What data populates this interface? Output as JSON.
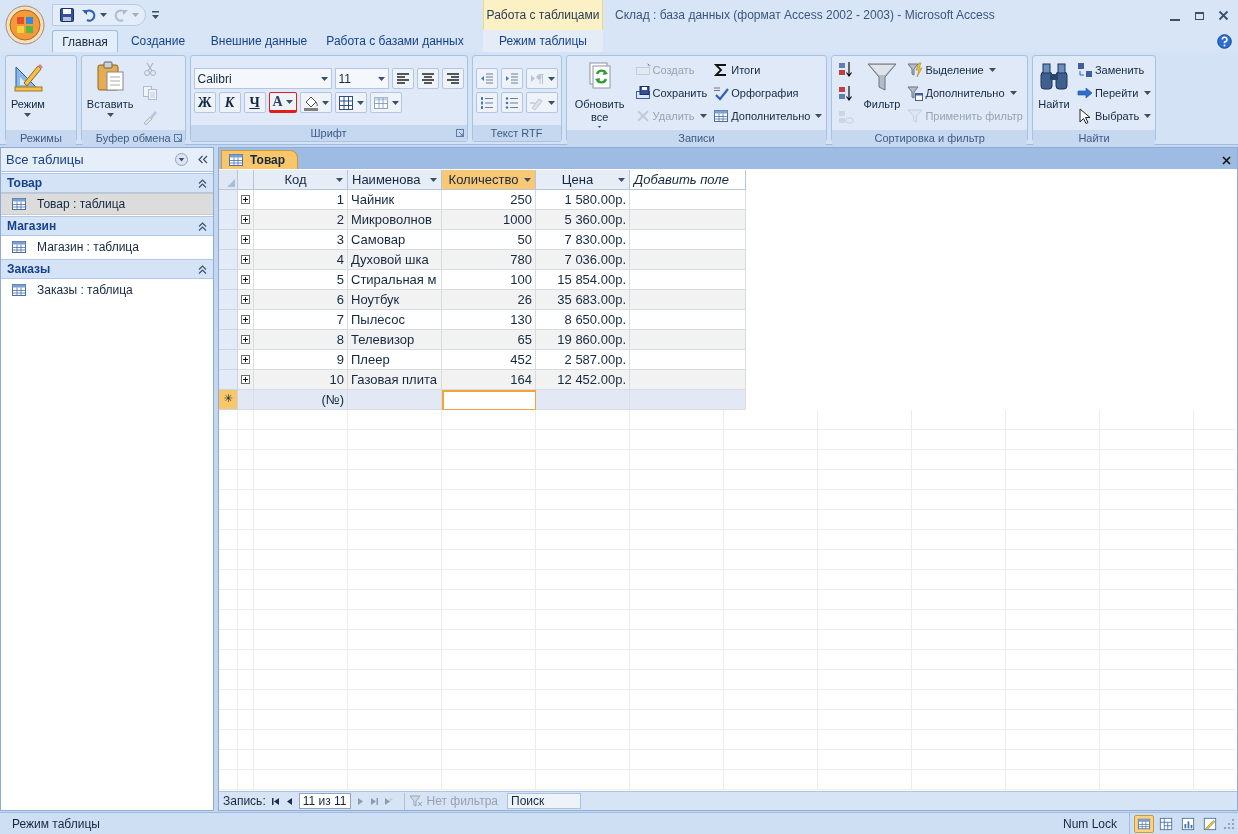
{
  "window": {
    "title": "Склад : база данных (формат Access 2002 - 2003) - Microsoft Access",
    "context_group": "Работа с таблицами"
  },
  "tabs": [
    {
      "label": "Главная",
      "selected": true,
      "contextual": false
    },
    {
      "label": "Создание",
      "selected": false,
      "contextual": false
    },
    {
      "label": "Внешние данные",
      "selected": false,
      "contextual": false
    },
    {
      "label": "Работа с базами данных",
      "selected": false,
      "contextual": false
    },
    {
      "label": "Режим таблицы",
      "selected": false,
      "contextual": true
    }
  ],
  "ribbon": [
    {
      "label": "Режимы",
      "launcher": false,
      "columns": [
        [
          [
            {
              "kind": "large",
              "label": "Режим",
              "dropdown": true,
              "disabled": false
            }
          ]
        ]
      ]
    },
    {
      "label": "Буфер обмена",
      "launcher": true,
      "columns": [
        [
          [
            {
              "kind": "large",
              "label": "Вставить",
              "dropdown": true,
              "disabled": false
            }
          ]
        ],
        [
          [
            {
              "kind": "icon",
              "dropdown": false,
              "disabled": true
            }
          ],
          [
            {
              "kind": "icon",
              "dropdown": false,
              "disabled": true
            }
          ],
          [
            {
              "kind": "icon",
              "dropdown": false,
              "disabled": true
            }
          ]
        ]
      ]
    },
    {
      "label": "Шрифт",
      "launcher": true,
      "columns": [
        [
          [
            {
              "kind": "font",
              "value": "Calibri"
            },
            {
              "kind": "size",
              "value": "11"
            },
            {
              "kind": "icon",
              "dropdown": false,
              "disabled": false
            },
            {
              "kind": "icon",
              "dropdown": false,
              "disabled": false
            },
            {
              "kind": "icon",
              "dropdown": false,
              "disabled": false
            }
          ],
          [
            {
              "kind": "glyph",
              "glyph": "Ж",
              "dropdown": false,
              "disabled": false
            },
            {
              "kind": "glyph",
              "glyph": "К",
              "dropdown": false,
              "disabled": false
            },
            {
              "kind": "glyph",
              "glyph": "Ч",
              "dropdown": false,
              "disabled": false
            },
            {
              "kind": "glyph",
              "glyph": "A",
              "dropdown": true,
              "disabled": false
            },
            {
              "kind": "icon",
              "dropdown": true,
              "disabled": false
            },
            {
              "kind": "icon",
              "dropdown": true,
              "disabled": false
            },
            {
              "kind": "icon",
              "dropdown": true,
              "disabled": false
            }
          ]
        ]
      ]
    },
    {
      "label": "Текст RTF",
      "launcher": false,
      "columns": [
        [
          [
            {
              "kind": "icon",
              "dropdown": false,
              "disabled": false
            },
            {
              "kind": "icon",
              "dropdown": false,
              "disabled": false
            },
            {
              "kind": "icon",
              "dropdown": true,
              "disabled": true
            }
          ],
          [
            {
              "kind": "icon",
              "dropdown": false,
              "disabled": false
            },
            {
              "kind": "icon",
              "dropdown": false,
              "disabled": false
            },
            {
              "kind": "icon",
              "dropdown": true,
              "disabled": true
            }
          ]
        ]
      ]
    },
    {
      "label": "Записи",
      "launcher": false,
      "columns": [
        [
          [
            {
              "kind": "large",
              "label": "Обновить все",
              "dropdown": true,
              "disabled": false
            }
          ]
        ],
        [
          [
            {
              "kind": "small",
              "label": "Создать",
              "dropdown": false,
              "disabled": true
            }
          ],
          [
            {
              "kind": "small",
              "label": "Сохранить",
              "dropdown": false,
              "disabled": false
            }
          ],
          [
            {
              "kind": "small",
              "label": "Удалить",
              "dropdown": true,
              "disabled": true
            }
          ]
        ],
        [
          [
            {
              "kind": "small",
              "label": "Итоги",
              "dropdown": false,
              "disabled": false
            }
          ],
          [
            {
              "kind": "small",
              "label": "Орфография",
              "dropdown": false,
              "disabled": false
            }
          ],
          [
            {
              "kind": "small",
              "label": "Дополнительно",
              "dropdown": true,
              "disabled": false
            }
          ]
        ]
      ]
    },
    {
      "label": "Сортировка и фильтр",
      "launcher": false,
      "columns": [
        [
          [
            {
              "kind": "icon",
              "dropdown": false,
              "disabled": false
            }
          ],
          [
            {
              "kind": "icon",
              "dropdown": false,
              "disabled": false
            }
          ],
          [
            {
              "kind": "icon",
              "dropdown": false,
              "disabled": true
            }
          ]
        ],
        [
          [
            {
              "kind": "large",
              "label": "Фильтр",
              "dropdown": false,
              "disabled": false
            }
          ]
        ],
        [
          [
            {
              "kind": "small",
              "label": "Выделение",
              "dropdown": true,
              "disabled": false
            }
          ],
          [
            {
              "kind": "small",
              "label": "Дополнительно",
              "dropdown": true,
              "disabled": false
            }
          ],
          [
            {
              "kind": "small",
              "label": "Применить фильтр",
              "dropdown": false,
              "disabled": true
            }
          ]
        ]
      ]
    },
    {
      "label": "Найти",
      "launcher": false,
      "columns": [
        [
          [
            {
              "kind": "large",
              "label": "Найти",
              "dropdown": false,
              "disabled": false
            }
          ]
        ],
        [
          [
            {
              "kind": "small",
              "label": "Заменить",
              "dropdown": false,
              "disabled": false
            }
          ],
          [
            {
              "kind": "small",
              "label": "Перейти",
              "dropdown": true,
              "disabled": false
            }
          ],
          [
            {
              "kind": "small",
              "label": "Выбрать",
              "dropdown": true,
              "disabled": false
            }
          ]
        ]
      ]
    }
  ],
  "nav": {
    "title": "Все таблицы",
    "groups": [
      {
        "title": "Товар",
        "items": [
          {
            "label": "Товар : таблица",
            "selected": true
          }
        ]
      },
      {
        "title": "Магазин",
        "items": [
          {
            "label": "Магазин : таблица",
            "selected": false
          }
        ]
      },
      {
        "title": "Заказы",
        "items": [
          {
            "label": "Заказы : таблица",
            "selected": false
          }
        ]
      }
    ]
  },
  "document": {
    "tab": "Товар",
    "table": {
      "columns": [
        {
          "label": "Код",
          "kind": "number",
          "selected": false
        },
        {
          "label": "Наименова",
          "kind": "text",
          "selected": false
        },
        {
          "label": "Количество",
          "kind": "number",
          "selected": true
        },
        {
          "label": "Цена",
          "kind": "number",
          "selected": false
        },
        {
          "label": "Добавить поле",
          "kind": "add",
          "selected": false
        }
      ],
      "rows": [
        [
          "1",
          "Чайник",
          "250",
          "1 580.00р."
        ],
        [
          "2",
          "Микроволнов",
          "1000",
          "5 360.00р."
        ],
        [
          "3",
          "Самовар",
          "50",
          "7 830.00р."
        ],
        [
          "4",
          "Духовой шка",
          "780",
          "7 036.00р."
        ],
        [
          "5",
          "Стиральная м",
          "100",
          "15 854.00р."
        ],
        [
          "6",
          "Ноутбук",
          "26",
          "35 683.00р."
        ],
        [
          "7",
          "Пылесос",
          "130",
          "8 650.00р."
        ],
        [
          "8",
          "Телевизор",
          "65",
          "19 860.00р."
        ],
        [
          "9",
          "Плеер",
          "452",
          "2 587.00р."
        ],
        [
          "10",
          "Газовая плита",
          "164",
          "12 452.00р."
        ]
      ],
      "new_row": {
        "marker": "✳",
        "id": "(№)"
      }
    },
    "record_nav": {
      "label": "Запись:",
      "position": "11 из 11",
      "filter": "Нет фильтра",
      "search_placeholder": "Поиск"
    }
  },
  "status_bar": {
    "mode": "Режим таблицы",
    "num_lock": "Num Lock",
    "views": [
      {
        "selected": true
      },
      {
        "selected": false
      },
      {
        "selected": false
      },
      {
        "selected": false
      }
    ]
  }
}
